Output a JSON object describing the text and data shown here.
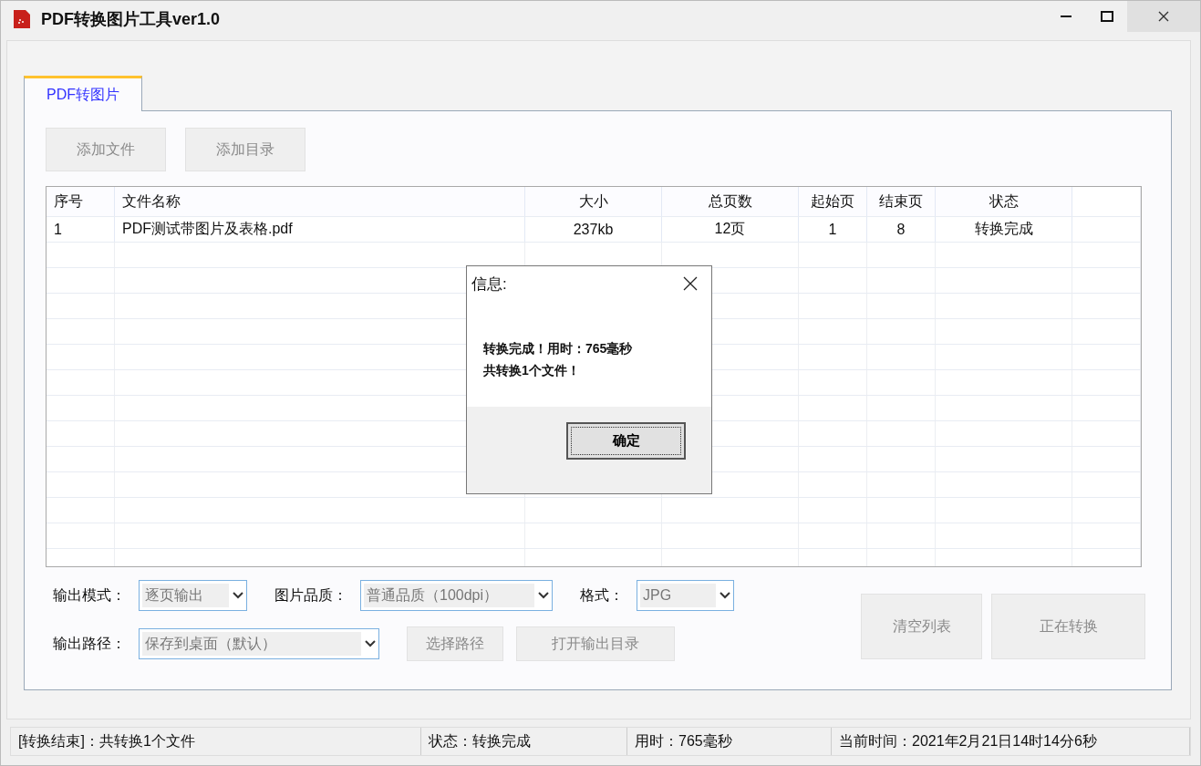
{
  "window": {
    "title": "PDF转换图片工具ver1.0"
  },
  "tabs": [
    {
      "label": "PDF转图片",
      "selected": true
    }
  ],
  "toolbar_buttons": [
    "添加文件",
    "添加目录"
  ],
  "table": {
    "columns": [
      "序号",
      "文件名称",
      "大小",
      "总页数",
      "起始页",
      "结束页",
      "状态"
    ],
    "rows": [
      [
        "1",
        "PDF测试带图片及表格.pdf",
        "237kb",
        "12页",
        "1",
        "8",
        "转换完成"
      ]
    ]
  },
  "options": [
    {
      "label": "输出模式：",
      "value": "逐页输出"
    },
    {
      "label": "图片品质：",
      "value": "普通品质（100dpi）"
    },
    {
      "label": "格式：",
      "value": "JPG"
    }
  ],
  "path": {
    "label": "输出路径：",
    "value": "保存到桌面（默认）"
  },
  "path_buttons": [
    "选择路径",
    "打开输出目录"
  ],
  "action_buttons": [
    "清空列表",
    "正在转换"
  ],
  "dialog": {
    "title": "信息:",
    "lines": [
      "转换完成！用时：765毫秒",
      "共转换1个文件！"
    ],
    "button": "确定"
  },
  "status_bar": [
    "[转换结束]：共转换1个文件",
    "状态：转换完成",
    "用时：765毫秒",
    "当前时间：2021年2月21日14时14分6秒"
  ]
}
